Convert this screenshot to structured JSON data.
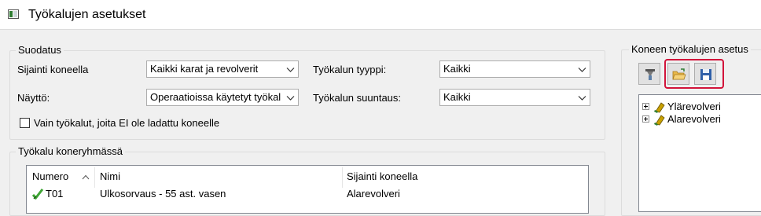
{
  "window": {
    "title": "Työkalujen asetukset"
  },
  "filter": {
    "group_title": "Suodatus",
    "location_label": "Sijainti koneella",
    "location_value": "Kaikki karat ja revolverit",
    "display_label": "Näyttö:",
    "display_value": "Operaatioissa käytetyt työkalut",
    "tool_type_label": "Työkalun tyyppi:",
    "tool_type_value": "Kaikki",
    "orientation_label": "Työkalun suuntaus:",
    "orientation_value": "Kaikki",
    "checkbox_label": "Vain työkalut, joita EI ole ladattu koneelle",
    "checkbox_checked": false
  },
  "group_tools": {
    "title": "Työkalu koneryhmässä",
    "columns": [
      "Numero",
      "Nimi",
      "Sijainti koneella"
    ],
    "rows": [
      {
        "number": "T01",
        "name": "Ulkosorvaus  - 55 ast. vasen",
        "location": "Alarevolveri"
      }
    ]
  },
  "machine_setup": {
    "title": "Koneen työkalujen asetus",
    "toolbar": [
      {
        "icon": "tool-holder-icon"
      },
      {
        "icon": "open-folder-icon"
      },
      {
        "icon": "save-icon"
      }
    ],
    "tree": [
      "Ylärevolveri",
      "Alarevolveri"
    ]
  },
  "colors": {
    "highlight": "#d2143a",
    "border": "#adadad"
  }
}
